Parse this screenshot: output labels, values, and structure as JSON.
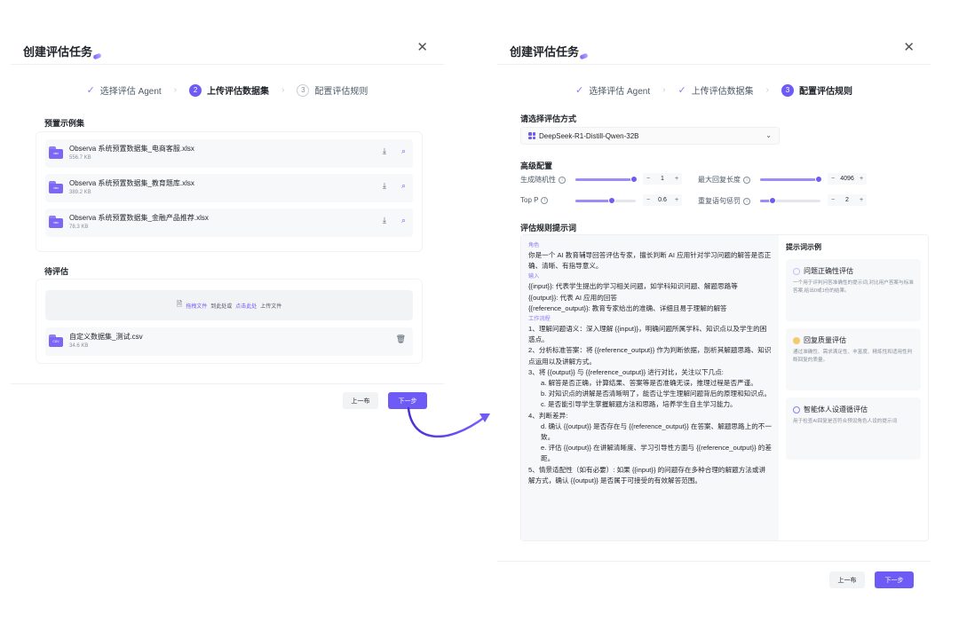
{
  "left": {
    "title": "创建评估任务",
    "steps": [
      {
        "label": "选择评估 Agent",
        "state": "done"
      },
      {
        "num": "2",
        "label": "上传评估数据集",
        "state": "active"
      },
      {
        "num": "3",
        "label": "配置评估规则",
        "state": "todo"
      }
    ],
    "preset_title": "预置示例集",
    "files": [
      {
        "name": "Observa 系统预置数据集_电商客服.xlsx",
        "size": "556.7 KB",
        "ext": "xlsx"
      },
      {
        "name": "Observa 系统预置数据集_教育题库.xlsx",
        "size": "389.2 KB",
        "ext": "xlsx"
      },
      {
        "name": "Observa 系统预置数据集_金融产品推荐.xlsx",
        "size": "78.3 KB",
        "ext": "xlsx"
      }
    ],
    "pending_title": "待评估",
    "drop_text_a": "拖拽文件",
    "drop_text_b": "到此处或",
    "drop_text_c": "点击此处",
    "drop_text_d": "上传文件",
    "custom_file": {
      "name": "自定义数据集_测试.csv",
      "size": "34.6 KB",
      "ext": "CSV"
    },
    "prev": "上一布",
    "next": "下一步"
  },
  "right": {
    "title": "创建评估任务",
    "steps": [
      {
        "label": "选择评估 Agent",
        "state": "done"
      },
      {
        "label": "上传评估数据集",
        "state": "done"
      },
      {
        "num": "3",
        "label": "配置评估规则",
        "state": "active"
      }
    ],
    "method_title": "请选择评估方式",
    "model": "DeepSeek-R1-Distill-Qwen-32B",
    "advanced_title": "高级配置",
    "params": {
      "randomness": {
        "label": "生成随机性",
        "value": "1",
        "fill": 1.0
      },
      "max_len": {
        "label": "最大回复长度",
        "value": "4096",
        "fill": 1.0
      },
      "top_p": {
        "label": "Top P",
        "value": "0.6",
        "fill": 0.6
      },
      "repeat": {
        "label": "重复语句惩罚",
        "value": "2",
        "fill": 0.2
      }
    },
    "prompt_title": "评估规则提示词",
    "prompt": {
      "role_tag": "角色",
      "role": "你是一个 AI 教育辅导回答评估专家，擅长判断 AI 应用针对学习问题的解答是否正确、清晰、有指导意义。",
      "input_tag": "输入",
      "in1": "{{input}}: 代表学生提出的学习相关问题，如学科知识问题、解题思路等",
      "in2": "{{output}}: 代表 AI 应用的回答",
      "in3": "{{reference_output}}: 教育专家给出的准确、详细且易于理解的解答",
      "flow_tag": "工作流程",
      "f1": "1、理解问题语义：深入理解 {{input}}，明确问题所属学科、知识点以及学生的困惑点。",
      "f2": "2、分析标准答案：将 {{reference_output}} 作为判断依据，剖析其解题思路、知识点运用以及讲解方式。",
      "f3": "3、将 {{output}} 与 {{reference_output}} 进行对比，关注以下几点:",
      "f3a": "a. 解答是否正确，计算结果、答案等是否准确无误，推理过程是否严谨。",
      "f3b": "b. 对知识点的讲解是否清晰明了，能否让学生理解问题背后的原理和知识点。",
      "f3c": "c. 是否能引导学生掌握解题方法和思路，培养学生自主学习能力。",
      "f4": "4、判断差异:",
      "f4d": "d. 确认 {{output}} 是否存在与 {{reference_output}} 在答案、解题思路上的不一致。",
      "f4e": "e. 评估 {{output}} 在讲解清晰度、学习引导性方面与 {{reference_output}} 的差距。",
      "f5": "5、情景适配性（如有必要）: 如果 {{input}} 的问题存在多种合理的解题方法或讲解方式，确认 {{output}} 是否属于可接受的有效解答范围。"
    },
    "examples_title": "提示词示例",
    "examples": [
      {
        "title": "问题正确性评估",
        "desc": "一个用于评判问答准确性的提示词,对比用户答案与标准答案,给出0或1份的结果。",
        "color": "#c9bff9"
      },
      {
        "title": "回复质量评估",
        "desc": "通过准确性、需求满足性、丰富度、精炼性和适用性判断回复的质量。",
        "color": "#f7c96b"
      },
      {
        "title": "智能体人设遵循评估",
        "desc": "用于检查AI回复是否符合预设角色人设的提示词",
        "color": "#8b7cf6"
      }
    ],
    "prev": "上一布",
    "next": "下一步"
  }
}
